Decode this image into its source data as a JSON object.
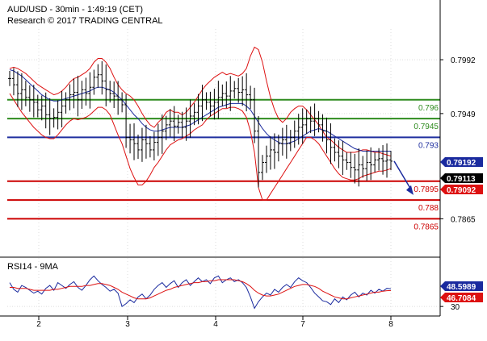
{
  "header": {
    "title": "AUD/USD - 30min - 1:49:19 (CET)",
    "subtitle": "Research © 2017 TRADING CENTRAL"
  },
  "colors": {
    "price": "#000000",
    "bollinger": "#dd1111",
    "moving_average": "#1a2a9e",
    "support_line": "#cc0000",
    "resistance_line": "#2e8b1e",
    "pivot_line": "#1f2f9f",
    "forecast_arrow": "#1a2a9e",
    "rsi_line": "#1a2a9e",
    "rsi_ma": "#dd1111",
    "tag_blue": "#1a2a9e",
    "tag_black": "#000000",
    "tag_red": "#dd1111",
    "grid": "#dddddd",
    "axis": "#000000"
  },
  "chart_data": [
    {
      "type": "line",
      "name": "price",
      "title": "AUD/USD - 30min - 1:49:19 (CET)",
      "x_ticks": [
        "2",
        "3",
        "4",
        "7",
        "8"
      ],
      "y_ticks": [
        0.7992,
        0.7949,
        0.7865
      ],
      "ylim": [
        0.7835,
        0.80165
      ],
      "grid": true,
      "close": [
        0.7977,
        0.7972,
        0.7965,
        0.7968,
        0.7962,
        0.796,
        0.7958,
        0.7952,
        0.7955,
        0.7948,
        0.7945,
        0.7946,
        0.795,
        0.7955,
        0.796,
        0.7964,
        0.7966,
        0.796,
        0.7968,
        0.7965,
        0.797,
        0.7978,
        0.798,
        0.7975,
        0.7968,
        0.7965,
        0.7963,
        0.796,
        0.7956,
        0.793,
        0.7928,
        0.7925,
        0.792,
        0.7928,
        0.7925,
        0.792,
        0.7926,
        0.793,
        0.7935,
        0.794,
        0.7943,
        0.7939,
        0.7942,
        0.7938,
        0.7943,
        0.7947,
        0.795,
        0.7955,
        0.796,
        0.7958,
        0.7955,
        0.7958,
        0.7962,
        0.7965,
        0.7963,
        0.7967,
        0.7969,
        0.7966,
        0.7968,
        0.7964,
        0.796,
        0.7935,
        0.7902,
        0.791,
        0.7915,
        0.792,
        0.7918,
        0.7925,
        0.7928,
        0.7925,
        0.793,
        0.7935,
        0.7938,
        0.794,
        0.7945,
        0.7943,
        0.7945,
        0.794,
        0.7935,
        0.7928,
        0.7922,
        0.7918,
        0.7915,
        0.7912,
        0.791,
        0.7906,
        0.7904,
        0.7908,
        0.7905,
        0.791,
        0.7908,
        0.7912,
        0.7913,
        0.7911,
        0.7912,
        0.7911
      ],
      "series": [
        {
          "name": "Bollinger upper",
          "values": [
            0.7985,
            0.7986,
            0.7985,
            0.7983,
            0.7981,
            0.7978,
            0.7975,
            0.7972,
            0.797,
            0.7968,
            0.7966,
            0.7964,
            0.7965,
            0.7967,
            0.797,
            0.7974,
            0.7977,
            0.7978,
            0.798,
            0.7982,
            0.7985,
            0.799,
            0.7993,
            0.7993,
            0.799,
            0.7985,
            0.7978,
            0.7972,
            0.7968,
            0.7965,
            0.7963,
            0.796,
            0.7955,
            0.7949,
            0.7944,
            0.794,
            0.7938,
            0.7942,
            0.7945,
            0.795,
            0.7952,
            0.795,
            0.795,
            0.7948,
            0.795,
            0.7954,
            0.7958,
            0.7963,
            0.7968,
            0.7972,
            0.7975,
            0.7978,
            0.798,
            0.7982,
            0.798,
            0.7981,
            0.798,
            0.7979,
            0.7981,
            0.7985,
            0.7995,
            0.8002,
            0.8,
            0.799,
            0.7975,
            0.7962,
            0.7952,
            0.7945,
            0.7942,
            0.7945,
            0.795,
            0.7953,
            0.7955,
            0.7955,
            0.7952,
            0.7948,
            0.7944,
            0.794,
            0.7935,
            0.793,
            0.7928,
            0.7925,
            0.7922,
            0.792,
            0.7918,
            0.7918,
            0.7918,
            0.7919,
            0.792,
            0.792,
            0.7919,
            0.7918,
            0.7918,
            0.7917,
            0.7916,
            0.7915
          ]
        },
        {
          "name": "Bollinger lower",
          "values": [
            0.7965,
            0.796,
            0.7955,
            0.795,
            0.7946,
            0.7942,
            0.7938,
            0.7935,
            0.7932,
            0.793,
            0.7929,
            0.7929,
            0.7932,
            0.7936,
            0.794,
            0.7943,
            0.7945,
            0.7944,
            0.7945,
            0.7946,
            0.7948,
            0.7951,
            0.7954,
            0.7954,
            0.7952,
            0.7948,
            0.794,
            0.7932,
            0.7925,
            0.7915,
            0.7905,
            0.7898,
            0.7892,
            0.7892,
            0.7895,
            0.79,
            0.7906,
            0.791,
            0.7915,
            0.792,
            0.7924,
            0.7926,
            0.7928,
            0.7929,
            0.7931,
            0.7933,
            0.7936,
            0.7938,
            0.794,
            0.7944,
            0.7947,
            0.7949,
            0.7951,
            0.7953,
            0.7953,
            0.7954,
            0.7954,
            0.7953,
            0.7951,
            0.7946,
            0.7935,
            0.7918,
            0.789,
            0.788,
            0.788,
            0.7885,
            0.789,
            0.7895,
            0.79,
            0.7905,
            0.791,
            0.7915,
            0.792,
            0.7925,
            0.793,
            0.793,
            0.7928,
            0.7925,
            0.792,
            0.7915,
            0.791,
            0.7905,
            0.7901,
            0.7898,
            0.7897,
            0.7896,
            0.7896,
            0.7897,
            0.7899,
            0.79,
            0.7901,
            0.7902,
            0.7903,
            0.7903,
            0.7904,
            0.7905
          ]
        },
        {
          "name": "Moving average",
          "values": [
            0.7984,
            0.7983,
            0.7981,
            0.7979,
            0.7976,
            0.7973,
            0.797,
            0.7967,
            0.7964,
            0.7962,
            0.796,
            0.7959,
            0.7959,
            0.796,
            0.7961,
            0.7962,
            0.7963,
            0.7964,
            0.7965,
            0.7966,
            0.7967,
            0.7969,
            0.797,
            0.797,
            0.7969,
            0.7968,
            0.7966,
            0.7963,
            0.796,
            0.7956,
            0.7952,
            0.7948,
            0.7945,
            0.7941,
            0.7938,
            0.7936,
            0.7935,
            0.7935,
            0.7936,
            0.7937,
            0.7938,
            0.7938,
            0.7938,
            0.7938,
            0.7939,
            0.794,
            0.7942,
            0.7944,
            0.7946,
            0.7948,
            0.795,
            0.7952,
            0.7954,
            0.7955,
            0.7956,
            0.7957,
            0.7957,
            0.7957,
            0.7957,
            0.7955,
            0.7952,
            0.7947,
            0.7942,
            0.7937,
            0.7933,
            0.793,
            0.7928,
            0.7926,
            0.7925,
            0.7925,
            0.7926,
            0.7927,
            0.7929,
            0.7931,
            0.7933,
            0.7935,
            0.7936,
            0.7937,
            0.7936,
            0.7935,
            0.7933,
            0.7931,
            0.7929,
            0.7927,
            0.7925,
            0.7923,
            0.7921,
            0.792,
            0.7919,
            0.7919,
            0.7919,
            0.7919,
            0.7919,
            0.7919,
            0.7919,
            0.7919
          ]
        }
      ],
      "levels": [
        {
          "label": "0.796",
          "value": 0.796,
          "kind": "resistance"
        },
        {
          "label": "0.7945",
          "value": 0.7945,
          "kind": "resistance"
        },
        {
          "label": "0.793",
          "value": 0.793,
          "kind": "pivot"
        },
        {
          "label": "0.7895",
          "value": 0.7895,
          "kind": "support"
        },
        {
          "label": "0.788",
          "value": 0.788,
          "kind": "support"
        },
        {
          "label": "0.7865",
          "value": 0.7865,
          "kind": "support"
        }
      ],
      "tags": [
        {
          "label": "0.79192",
          "value": 0.79192,
          "style": "blue"
        },
        {
          "label": "0.79113",
          "value": 0.79113,
          "style": "black"
        },
        {
          "label": "0.79092",
          "value": 0.79092,
          "style": "red"
        }
      ],
      "forecast": {
        "from_value": 0.7911,
        "to_value": 0.7884
      }
    },
    {
      "type": "line",
      "name": "rsi",
      "title": "RSI14 - 9MA",
      "ylim": [
        20,
        80
      ],
      "y_ticks": [
        30
      ],
      "series": [
        {
          "name": "RSI14",
          "values": [
            55,
            48,
            45,
            52,
            50,
            47,
            44,
            46,
            43,
            49,
            52,
            47,
            55,
            52,
            49,
            53,
            56,
            50,
            47,
            52,
            58,
            62,
            57,
            53,
            50,
            46,
            48,
            44,
            30,
            33,
            37,
            34,
            40,
            43,
            38,
            42,
            48,
            52,
            55,
            50,
            54,
            57,
            50,
            55,
            58,
            52,
            56,
            60,
            56,
            58,
            54,
            60,
            62,
            55,
            58,
            60,
            56,
            58,
            55,
            50,
            40,
            28,
            35,
            40,
            44,
            42,
            48,
            45,
            50,
            53,
            50,
            56,
            60,
            57,
            55,
            50,
            44,
            40,
            36,
            35,
            32,
            38,
            34,
            40,
            37,
            42,
            45,
            40,
            44,
            42,
            47,
            44,
            48,
            46,
            49,
            48.6
          ]
        },
        {
          "name": "9MA",
          "values": [
            50,
            50,
            49,
            49,
            49,
            48,
            47,
            47,
            47,
            47,
            47,
            48,
            48,
            49,
            50,
            51,
            51,
            51,
            51,
            52,
            52,
            53,
            54,
            54,
            53,
            52,
            50,
            48,
            45,
            43,
            41,
            39,
            38,
            38,
            38,
            39,
            41,
            43,
            45,
            47,
            48,
            50,
            51,
            52,
            53,
            54,
            55,
            55,
            56,
            56,
            57,
            57,
            58,
            58,
            58,
            58,
            58,
            57,
            56,
            54,
            51,
            47,
            44,
            42,
            41,
            41,
            42,
            43,
            45,
            47,
            49,
            51,
            52,
            53,
            53,
            52,
            51,
            49,
            46,
            44,
            42,
            40,
            39,
            38,
            38,
            39,
            40,
            41,
            42,
            43,
            44,
            45,
            45,
            46,
            46.5,
            46.7
          ]
        }
      ],
      "tags": [
        {
          "label": "48.5989",
          "value": 48.5989,
          "style": "blue"
        },
        {
          "label": "46.7084",
          "value": 46.7084,
          "style": "red"
        }
      ]
    }
  ]
}
